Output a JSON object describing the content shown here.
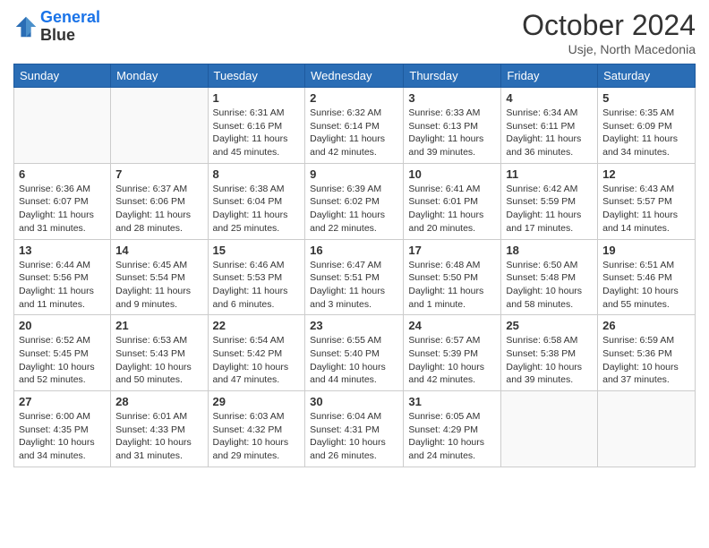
{
  "header": {
    "logo_line1": "General",
    "logo_line2": "Blue",
    "month": "October 2024",
    "location": "Usje, North Macedonia"
  },
  "weekdays": [
    "Sunday",
    "Monday",
    "Tuesday",
    "Wednesday",
    "Thursday",
    "Friday",
    "Saturday"
  ],
  "weeks": [
    [
      {
        "day": "",
        "detail": ""
      },
      {
        "day": "",
        "detail": ""
      },
      {
        "day": "1",
        "detail": "Sunrise: 6:31 AM\nSunset: 6:16 PM\nDaylight: 11 hours\nand 45 minutes."
      },
      {
        "day": "2",
        "detail": "Sunrise: 6:32 AM\nSunset: 6:14 PM\nDaylight: 11 hours\nand 42 minutes."
      },
      {
        "day": "3",
        "detail": "Sunrise: 6:33 AM\nSunset: 6:13 PM\nDaylight: 11 hours\nand 39 minutes."
      },
      {
        "day": "4",
        "detail": "Sunrise: 6:34 AM\nSunset: 6:11 PM\nDaylight: 11 hours\nand 36 minutes."
      },
      {
        "day": "5",
        "detail": "Sunrise: 6:35 AM\nSunset: 6:09 PM\nDaylight: 11 hours\nand 34 minutes."
      }
    ],
    [
      {
        "day": "6",
        "detail": "Sunrise: 6:36 AM\nSunset: 6:07 PM\nDaylight: 11 hours\nand 31 minutes."
      },
      {
        "day": "7",
        "detail": "Sunrise: 6:37 AM\nSunset: 6:06 PM\nDaylight: 11 hours\nand 28 minutes."
      },
      {
        "day": "8",
        "detail": "Sunrise: 6:38 AM\nSunset: 6:04 PM\nDaylight: 11 hours\nand 25 minutes."
      },
      {
        "day": "9",
        "detail": "Sunrise: 6:39 AM\nSunset: 6:02 PM\nDaylight: 11 hours\nand 22 minutes."
      },
      {
        "day": "10",
        "detail": "Sunrise: 6:41 AM\nSunset: 6:01 PM\nDaylight: 11 hours\nand 20 minutes."
      },
      {
        "day": "11",
        "detail": "Sunrise: 6:42 AM\nSunset: 5:59 PM\nDaylight: 11 hours\nand 17 minutes."
      },
      {
        "day": "12",
        "detail": "Sunrise: 6:43 AM\nSunset: 5:57 PM\nDaylight: 11 hours\nand 14 minutes."
      }
    ],
    [
      {
        "day": "13",
        "detail": "Sunrise: 6:44 AM\nSunset: 5:56 PM\nDaylight: 11 hours\nand 11 minutes."
      },
      {
        "day": "14",
        "detail": "Sunrise: 6:45 AM\nSunset: 5:54 PM\nDaylight: 11 hours\nand 9 minutes."
      },
      {
        "day": "15",
        "detail": "Sunrise: 6:46 AM\nSunset: 5:53 PM\nDaylight: 11 hours\nand 6 minutes."
      },
      {
        "day": "16",
        "detail": "Sunrise: 6:47 AM\nSunset: 5:51 PM\nDaylight: 11 hours\nand 3 minutes."
      },
      {
        "day": "17",
        "detail": "Sunrise: 6:48 AM\nSunset: 5:50 PM\nDaylight: 11 hours\nand 1 minute."
      },
      {
        "day": "18",
        "detail": "Sunrise: 6:50 AM\nSunset: 5:48 PM\nDaylight: 10 hours\nand 58 minutes."
      },
      {
        "day": "19",
        "detail": "Sunrise: 6:51 AM\nSunset: 5:46 PM\nDaylight: 10 hours\nand 55 minutes."
      }
    ],
    [
      {
        "day": "20",
        "detail": "Sunrise: 6:52 AM\nSunset: 5:45 PM\nDaylight: 10 hours\nand 52 minutes."
      },
      {
        "day": "21",
        "detail": "Sunrise: 6:53 AM\nSunset: 5:43 PM\nDaylight: 10 hours\nand 50 minutes."
      },
      {
        "day": "22",
        "detail": "Sunrise: 6:54 AM\nSunset: 5:42 PM\nDaylight: 10 hours\nand 47 minutes."
      },
      {
        "day": "23",
        "detail": "Sunrise: 6:55 AM\nSunset: 5:40 PM\nDaylight: 10 hours\nand 44 minutes."
      },
      {
        "day": "24",
        "detail": "Sunrise: 6:57 AM\nSunset: 5:39 PM\nDaylight: 10 hours\nand 42 minutes."
      },
      {
        "day": "25",
        "detail": "Sunrise: 6:58 AM\nSunset: 5:38 PM\nDaylight: 10 hours\nand 39 minutes."
      },
      {
        "day": "26",
        "detail": "Sunrise: 6:59 AM\nSunset: 5:36 PM\nDaylight: 10 hours\nand 37 minutes."
      }
    ],
    [
      {
        "day": "27",
        "detail": "Sunrise: 6:00 AM\nSunset: 4:35 PM\nDaylight: 10 hours\nand 34 minutes."
      },
      {
        "day": "28",
        "detail": "Sunrise: 6:01 AM\nSunset: 4:33 PM\nDaylight: 10 hours\nand 31 minutes."
      },
      {
        "day": "29",
        "detail": "Sunrise: 6:03 AM\nSunset: 4:32 PM\nDaylight: 10 hours\nand 29 minutes."
      },
      {
        "day": "30",
        "detail": "Sunrise: 6:04 AM\nSunset: 4:31 PM\nDaylight: 10 hours\nand 26 minutes."
      },
      {
        "day": "31",
        "detail": "Sunrise: 6:05 AM\nSunset: 4:29 PM\nDaylight: 10 hours\nand 24 minutes."
      },
      {
        "day": "",
        "detail": ""
      },
      {
        "day": "",
        "detail": ""
      }
    ]
  ]
}
